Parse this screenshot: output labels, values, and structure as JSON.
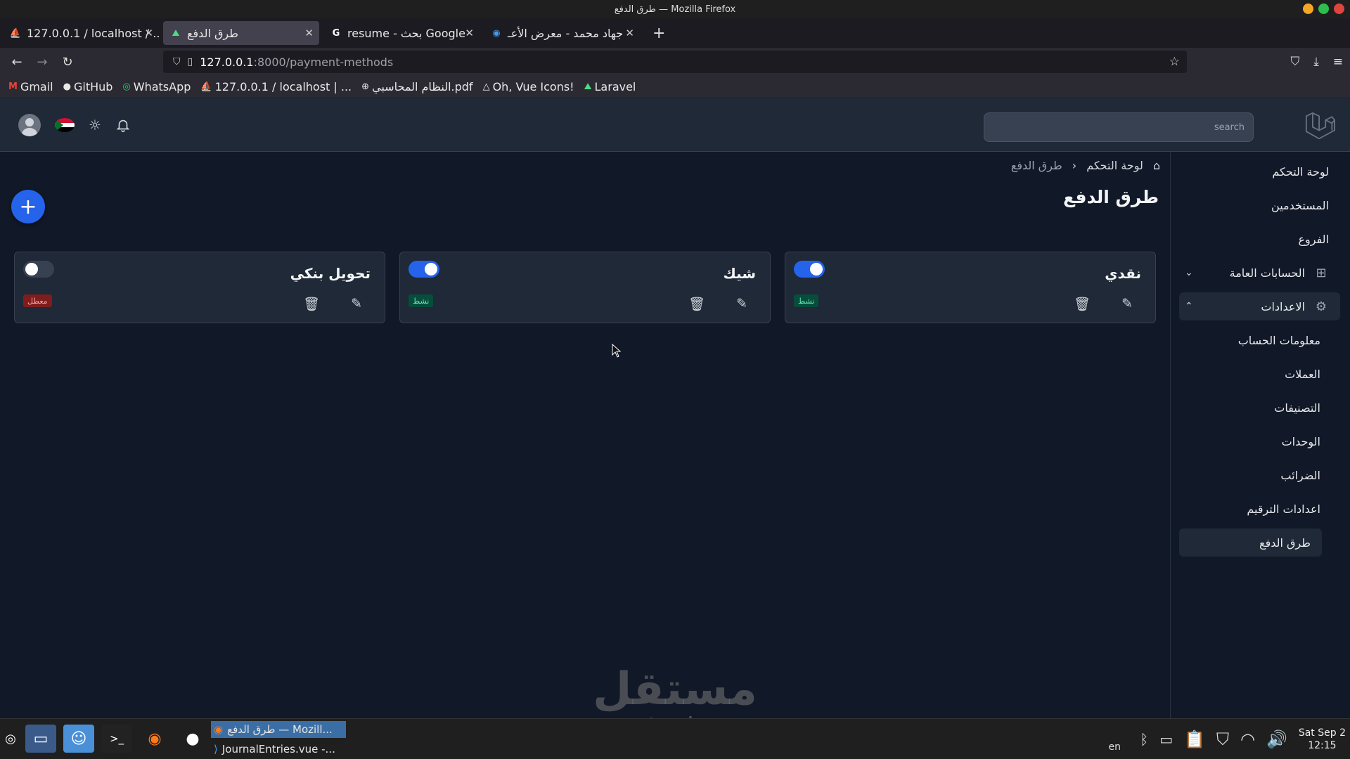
{
  "window": {
    "title": "طرق الدفع — Mozilla Firefox"
  },
  "tabs": [
    {
      "label": "127.0.0.1 / localhost / ...",
      "icon": "phpmyadmin-icon",
      "active": false
    },
    {
      "label": "طرق الدفع",
      "icon": "laravel-icon",
      "active": true
    },
    {
      "label": "resume - بحث Google",
      "icon": "google-icon",
      "active": false
    },
    {
      "label": "جهاد محمد - معرض الأعـ",
      "icon": "chrome-icon",
      "active": false
    }
  ],
  "url": {
    "host": "127.0.0.1",
    "path": ":8000/payment-methods"
  },
  "bookmarks": [
    {
      "label": "Gmail",
      "icon": "gmail-icon"
    },
    {
      "label": "GitHub",
      "icon": "github-icon"
    },
    {
      "label": "WhatsApp",
      "icon": "whatsapp-icon"
    },
    {
      "label": "127.0.0.1 / localhost | ...",
      "icon": "phpmyadmin-icon"
    },
    {
      "label": "النظام المحاسبي.pdf",
      "icon": "globe-icon"
    },
    {
      "label": "Oh, Vue Icons!",
      "icon": "vue-icon"
    },
    {
      "label": "Laravel",
      "icon": "laravel-icon"
    }
  ],
  "header": {
    "search_placeholder": "search"
  },
  "breadcrumb": {
    "home": "لوحة التحكم",
    "current": "طرق الدفع"
  },
  "page": {
    "title": "طرق الدفع"
  },
  "sidebar": {
    "items": [
      {
        "label": "لوحة التحكم"
      },
      {
        "label": "المستخدمين"
      },
      {
        "label": "الفروع"
      },
      {
        "label": "الحسابات العامة"
      },
      {
        "label": "الاعدادات"
      }
    ],
    "settings_sub": [
      {
        "label": "معلومات الحساب"
      },
      {
        "label": "العملات"
      },
      {
        "label": "التصنيفات"
      },
      {
        "label": "الوحدات"
      },
      {
        "label": "الضرائب"
      },
      {
        "label": "اعدادات الترقيم"
      },
      {
        "label": "طرق الدفع"
      }
    ]
  },
  "cards": [
    {
      "name": "نقدي",
      "status": "نشط",
      "enabled": true
    },
    {
      "name": "شيك",
      "status": "نشط",
      "enabled": true
    },
    {
      "name": "تحويل بنكي",
      "status": "معطل",
      "enabled": false
    }
  ],
  "watermark": {
    "arabic": "مستقل",
    "latin": "mostaql.com"
  },
  "taskbar": {
    "windows": [
      {
        "label": "طرق الدفع — Mozill..."
      },
      {
        "label": "JournalEntries.vue -..."
      }
    ],
    "lang": "en",
    "clock": {
      "date": "Sat Sep  2",
      "time": "12:15"
    }
  },
  "colors": {
    "accent": "#2563eb",
    "active_badge": "#064e3b",
    "inactive_badge": "#7f1d1d"
  }
}
